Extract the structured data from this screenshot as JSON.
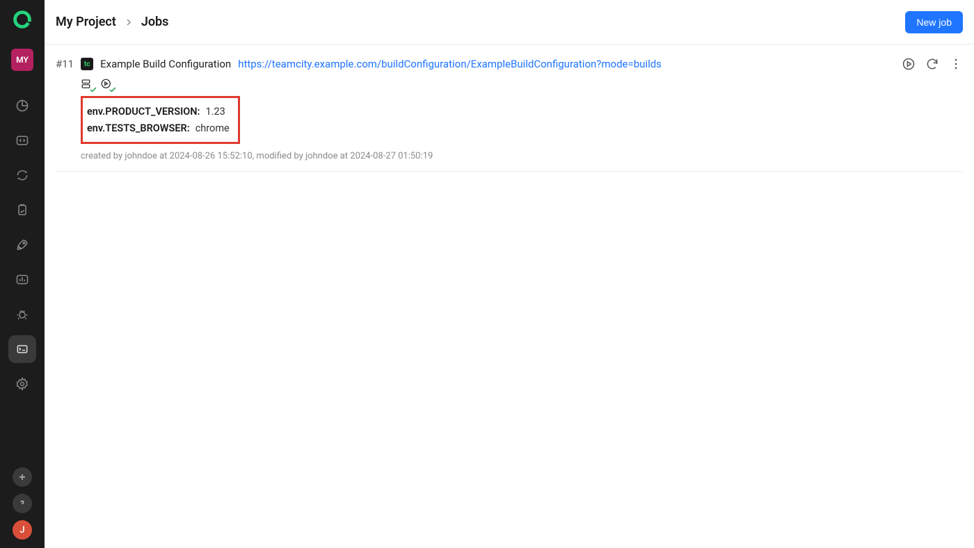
{
  "sidebar": {
    "project_badge": "MY",
    "user_initial": "J"
  },
  "header": {
    "breadcrumb": [
      "My Project",
      "Jobs"
    ],
    "new_button": "New job"
  },
  "job": {
    "id": "#11",
    "name": "Example Build Configuration",
    "link": "https://teamcity.example.com/buildConfiguration/ExampleBuildConfiguration?mode=builds",
    "env": [
      {
        "key": "env.PRODUCT_VERSION:",
        "value": "1.23"
      },
      {
        "key": "env.TESTS_BROWSER:",
        "value": "chrome"
      }
    ],
    "meta": "created by johndoe at 2024-08-26 15:52:10, modified by johndoe at 2024-08-27 01:50:19"
  }
}
